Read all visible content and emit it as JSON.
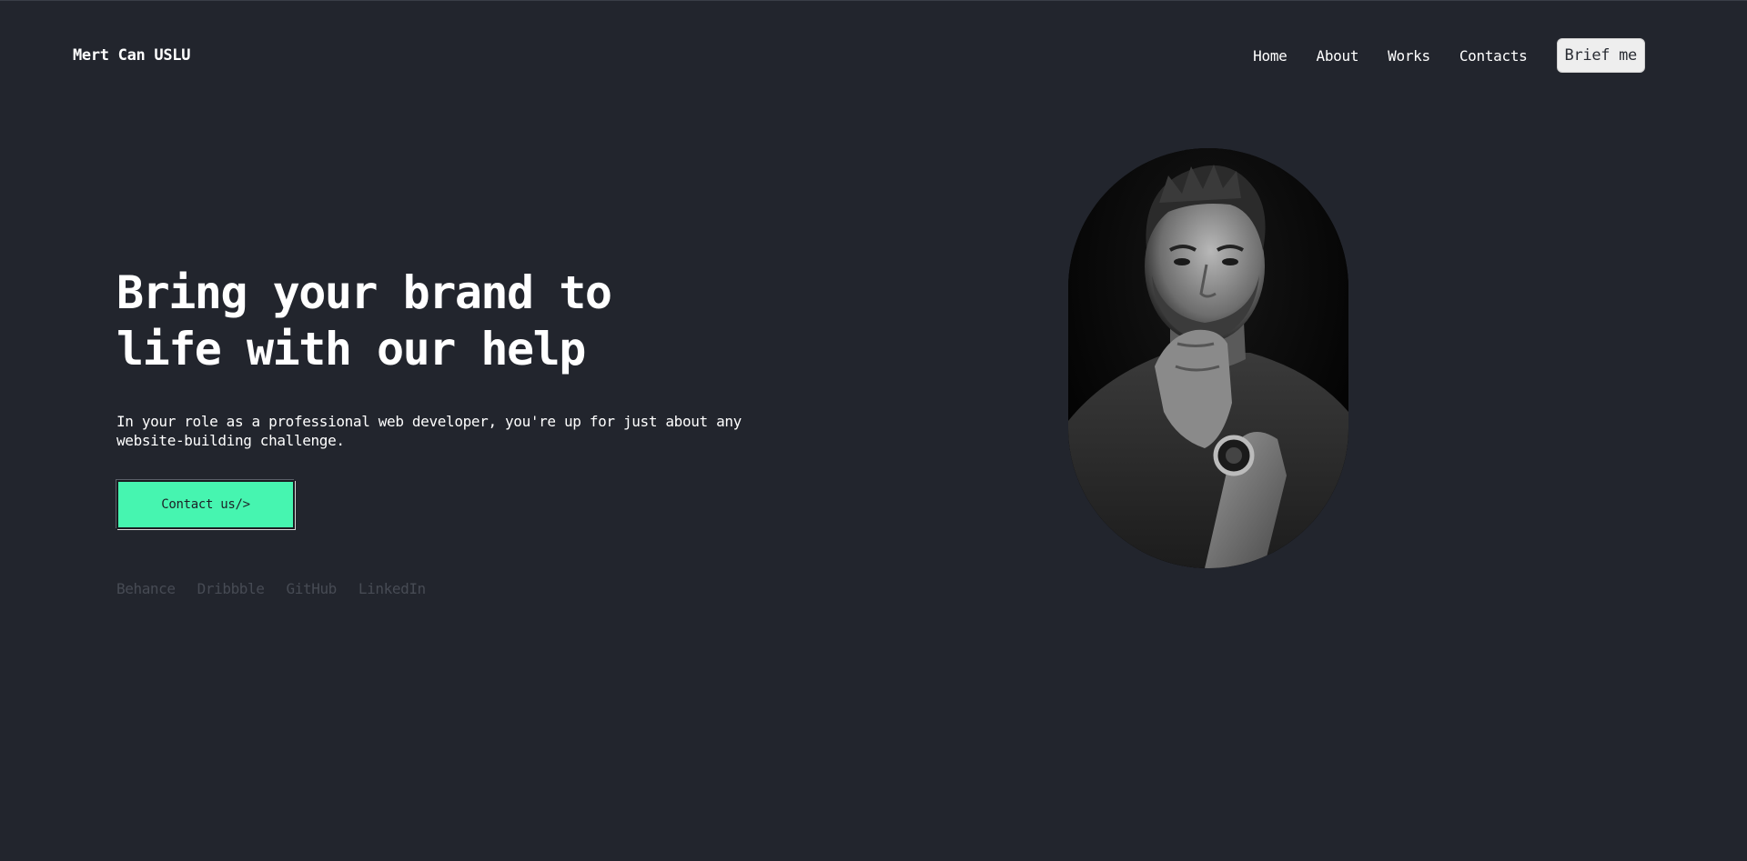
{
  "header": {
    "logo": "Mert Can USLU",
    "nav": [
      "Home",
      "About",
      "Works",
      "Contacts"
    ],
    "cta_label": "Brief me"
  },
  "hero": {
    "title": "Bring your brand to life with our help",
    "description": "In your role as a professional web developer, you're up for just about any website-building challenge.",
    "button_label": "Contact us/>",
    "socials": [
      "Behance",
      "Dribbble",
      "GitHub",
      "LinkedIn"
    ]
  },
  "colors": {
    "background": "#22252d",
    "accent": "#46f5b0",
    "muted_link": "#474b54",
    "brief_button_bg": "#eeeeee"
  },
  "portrait": {
    "icon": "portrait-photo"
  }
}
